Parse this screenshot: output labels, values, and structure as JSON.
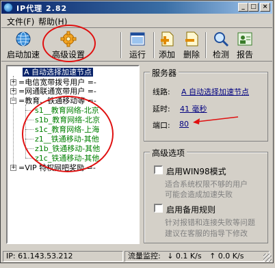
{
  "window": {
    "title": "IP代理 2.82"
  },
  "menu": {
    "items": [
      "文件(F)",
      "帮助(H)"
    ]
  },
  "toolbar": {
    "quick_start": "启动加速",
    "advanced": "高级设置",
    "run": "运行",
    "add": "添加",
    "delete": "删除",
    "check": "检测",
    "report": "报告"
  },
  "tree": {
    "selected": "A  自动选择加速节点",
    "groups": [
      "=电信宽带拨号用户 =-",
      "=网通联通宽带用户 =-",
      "=教育、铁通移动等 =-",
      "=VIP 特权网吧奖励 =-"
    ],
    "children": [
      "s1__教育网络-北京",
      "s1b_教育网络-北京",
      "s1c_教育网络-上海",
      "z1__铁通移动-其他",
      "z1b_铁通移动-其他",
      "z1c_铁通移动-其他"
    ]
  },
  "server": {
    "title": "服务器",
    "line_label": "线路:",
    "line_value": "A  自动选择加速节点",
    "delay_label": "延时:",
    "delay_value": "41 毫秒",
    "port_label": "端口:",
    "port_value": "80"
  },
  "advanced": {
    "title": "高级选项",
    "win98_label": "启用WIN98模式",
    "win98_desc_1": "适合系统权限不够的用户",
    "win98_desc_2": "可能会造成加速失败",
    "backup_label": "启用备用规则",
    "backup_desc_1": "针对报错和连接失败等问题",
    "backup_desc_2": "建议在客服的指导下修改"
  },
  "status": {
    "ip": "IP: 61.143.53.212",
    "traffic_label": "流量监控:",
    "down": "↓ 0.1 K/s",
    "up": "↑ 0.0 K/s"
  },
  "colors": {
    "title_bar": "#0a246a",
    "selection": "#0a246a",
    "annotation": "#e01010",
    "tree_child": "#008000"
  }
}
